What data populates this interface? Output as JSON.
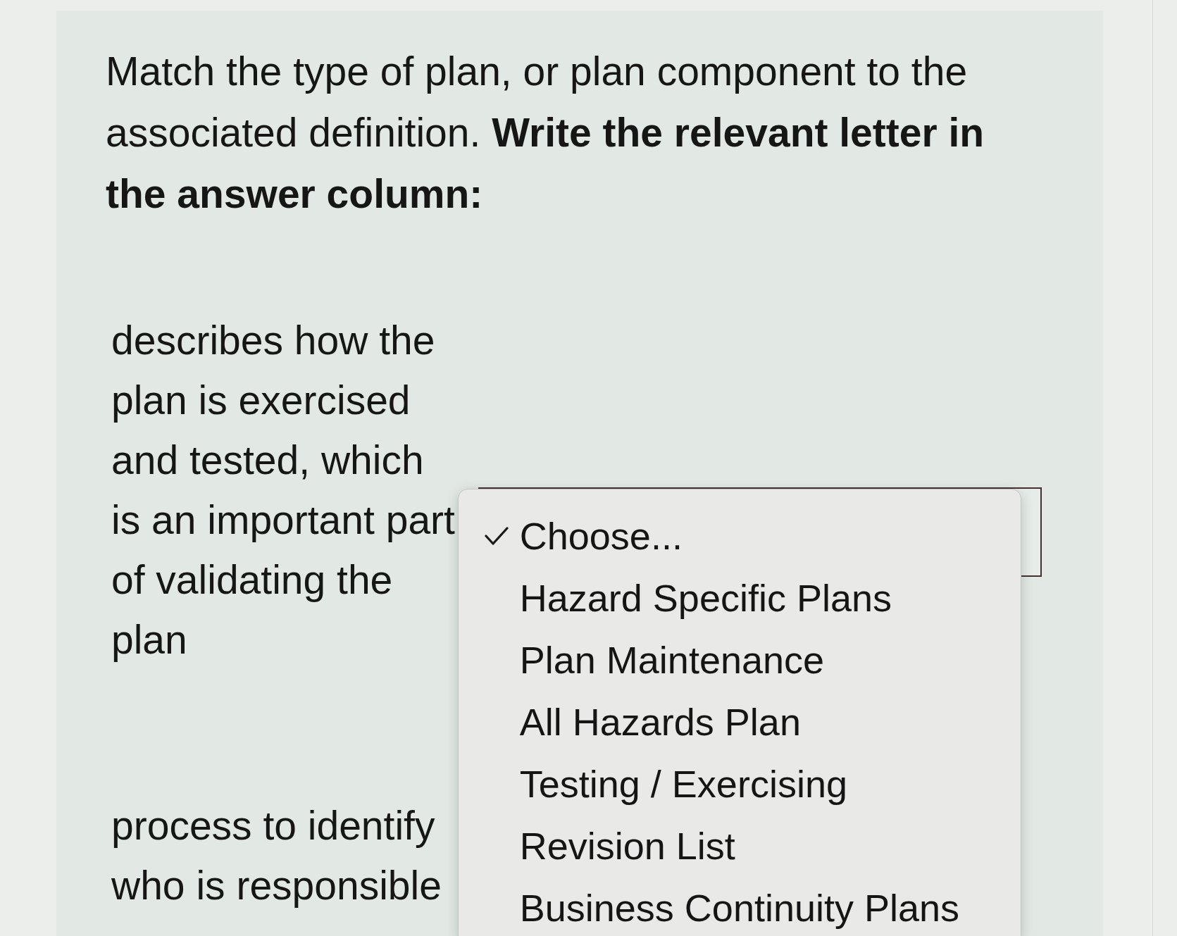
{
  "question": {
    "text": "Match the type of plan, or plan component to the associated definition. **Write the relevant letter in the answer column:**"
  },
  "rows": [
    {
      "definition": "describes how the plan is exercised and tested, which is an important part of validating the plan",
      "answer": {
        "expanded": true,
        "options": [
          {
            "label": "Choose...",
            "selected": true
          },
          {
            "label": "Hazard Specific Plans",
            "selected": false
          },
          {
            "label": "Plan Maintenance",
            "selected": false
          },
          {
            "label": "All Hazards Plan",
            "selected": false
          },
          {
            "label": "Testing / Exercising",
            "selected": false
          },
          {
            "label": "Revision List",
            "selected": false
          },
          {
            "label": "Business Continuity Plans",
            "selected": false
          }
        ]
      }
    },
    {
      "definition": "process to identify who is responsible"
    }
  ]
}
